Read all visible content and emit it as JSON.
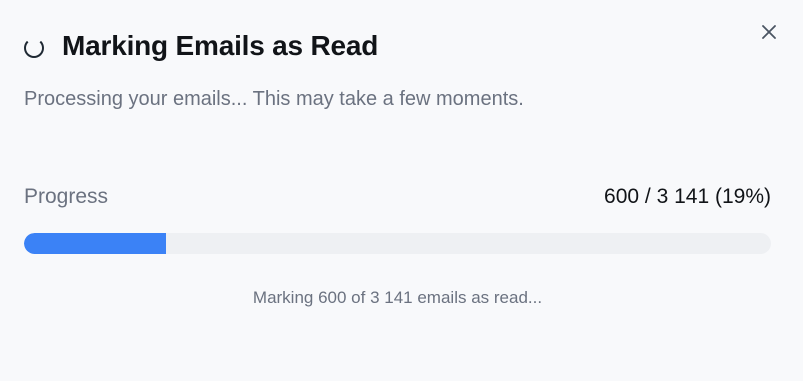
{
  "dialog": {
    "title": "Marking Emails as Read",
    "subtitle": "Processing your emails... This may take a few moments.",
    "close_icon": "close-icon",
    "spinner_icon": "spinner-icon"
  },
  "progress": {
    "label": "Progress",
    "count_text": "600 / 3 141 (19%)",
    "fraction": 0.19,
    "done": 600,
    "total": 3141,
    "fill_color": "#3b82f6"
  },
  "status": {
    "message": "Marking 600 of 3 141 emails as read..."
  }
}
